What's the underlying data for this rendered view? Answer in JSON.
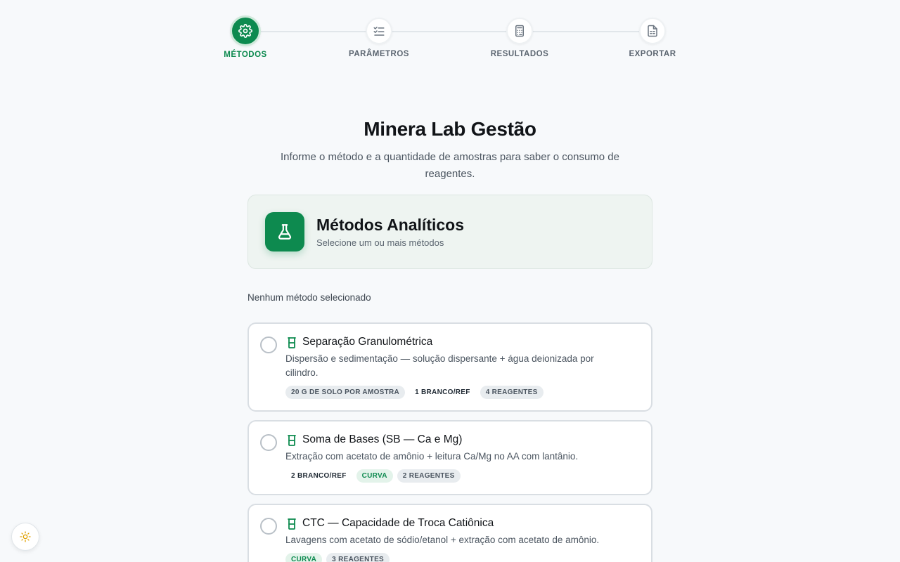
{
  "stepper": {
    "steps": [
      {
        "label": "MÉTODOS",
        "icon": "gear-icon",
        "active": true
      },
      {
        "label": "PARÂMETROS",
        "icon": "list-check-icon",
        "active": false
      },
      {
        "label": "RESULTADOS",
        "icon": "calculator-icon",
        "active": false
      },
      {
        "label": "EXPORTAR",
        "icon": "document-icon",
        "active": false
      }
    ]
  },
  "header": {
    "title": "Minera Lab Gestão",
    "subtitle": "Informe o método e a quantidade de amostras para saber o consumo de reagentes."
  },
  "section": {
    "icon": "flask-icon",
    "title": "Métodos Analíticos",
    "subtitle": "Selecione um ou mais métodos"
  },
  "selection_status": "Nenhum método selecionado",
  "methods": [
    {
      "name": "Separação Granulométrica",
      "description": "Dispersão e sedimentação — solução dispersante + água deionizada por cilindro.",
      "tags": [
        {
          "text": "20 G DE SOLO POR AMOSTRA",
          "style": "gray"
        },
        {
          "text": "1 BRANCO/REF",
          "style": "plain"
        },
        {
          "text": "4 REAGENTES",
          "style": "gray"
        }
      ]
    },
    {
      "name": "Soma de Bases (SB — Ca e Mg)",
      "description": "Extração com acetato de amônio + leitura Ca/Mg no AA com lantânio.",
      "tags": [
        {
          "text": "2 BRANCO/REF",
          "style": "plain"
        },
        {
          "text": "CURVA",
          "style": "green"
        },
        {
          "text": "2 REAGENTES",
          "style": "gray"
        }
      ]
    },
    {
      "name": "CTC — Capacidade de Troca Catiônica",
      "description": "Lavagens com acetato de sódio/etanol + extração com acetato de amônio.",
      "tags": [
        {
          "text": "CURVA",
          "style": "green"
        },
        {
          "text": "3 REAGENTES",
          "style": "gray"
        }
      ]
    }
  ],
  "colors": {
    "accent": "#0d8a4f",
    "accent_soft": "#e3f3ea",
    "border": "#d9dee3",
    "background": "#f7f9fb"
  },
  "theme_toggle": {
    "icon": "sun-icon"
  }
}
